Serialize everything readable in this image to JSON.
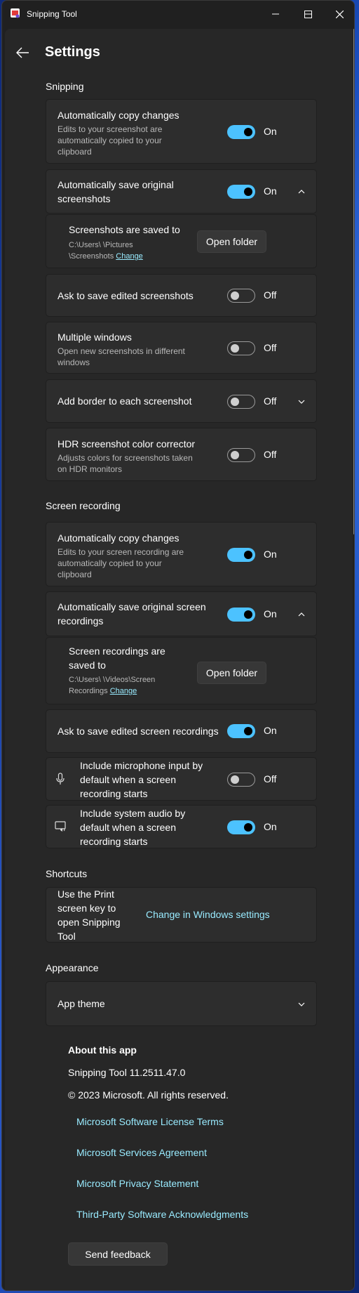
{
  "window": {
    "title": "Snipping Tool"
  },
  "page": {
    "title": "Settings"
  },
  "sections": {
    "snipping": "Snipping",
    "screen_recording": "Screen recording",
    "shortcuts": "Shortcuts",
    "appearance": "Appearance"
  },
  "snipping": {
    "auto_copy": {
      "title": "Automatically copy changes",
      "desc": [
        "Edits to your screenshot are",
        "automatically copied to your",
        "clipboard"
      ],
      "state": "On"
    },
    "auto_save": {
      "title": [
        "Automatically save original",
        "screenshots"
      ],
      "state": "On"
    },
    "saved_to": {
      "title": "Screenshots are saved to",
      "path1": "C:\\Users\\           \\Pictures",
      "path2": "\\Screenshots",
      "change": "Change",
      "button": "Open folder"
    },
    "ask_save": {
      "title": "Ask to save edited screenshots",
      "state": "Off"
    },
    "multi_win": {
      "title": "Multiple windows",
      "desc": [
        "Open new screenshots in different",
        "windows"
      ],
      "state": "Off"
    },
    "border": {
      "title": "Add border to each screenshot",
      "state": "Off"
    },
    "hdr": {
      "title": "HDR screenshot color corrector",
      "desc": [
        "Adjusts colors for screenshots taken",
        "on HDR monitors"
      ],
      "state": "Off"
    }
  },
  "recording": {
    "auto_copy": {
      "title": "Automatically copy changes",
      "desc": [
        "Edits to your screen recording are",
        "automatically copied to your",
        "clipboard"
      ],
      "state": "On"
    },
    "auto_save": {
      "title": [
        "Automatically save original screen",
        "recordings"
      ],
      "state": "On"
    },
    "saved_to": {
      "title": [
        "Screen recordings are",
        "saved to"
      ],
      "path1": "C:\\Users\\           \\Videos\\Screen",
      "path2": "Recordings",
      "change": "Change",
      "button": "Open folder"
    },
    "ask_save": {
      "title": "Ask to save edited screen recordings",
      "state": "On"
    },
    "mic": {
      "title": [
        "Include microphone input by",
        "default when a screen",
        "recording starts"
      ],
      "state": "Off"
    },
    "audio": {
      "title": [
        "Include system audio by",
        "default when a screen",
        "recording starts"
      ],
      "state": "On"
    }
  },
  "shortcuts": {
    "print": {
      "title": [
        "Use the Print",
        "screen key to",
        "open Snipping",
        "Tool"
      ],
      "link": "Change in Windows settings"
    }
  },
  "appearance": {
    "theme": {
      "title": "App theme"
    }
  },
  "about": {
    "heading": "About this app",
    "version": "Snipping Tool 11.2511.47.0",
    "copyright": "© 2023 Microsoft. All rights reserved.",
    "links": [
      "Microsoft Software License Terms",
      "Microsoft Services Agreement",
      "Microsoft Privacy Statement",
      "Third-Party Software Acknowledgments"
    ],
    "feedback": "Send feedback"
  },
  "colors": {
    "accent": "#4cc2ff",
    "link": "#99ebff",
    "window_bg": "#202020",
    "card_bg": "#2d2d2d"
  },
  "icons": [
    "app-icon",
    "minimize-icon",
    "maximize-icon",
    "close-icon",
    "back-arrow-icon",
    "chevron-up-icon",
    "chevron-down-icon",
    "microphone-icon",
    "system-audio-icon"
  ]
}
